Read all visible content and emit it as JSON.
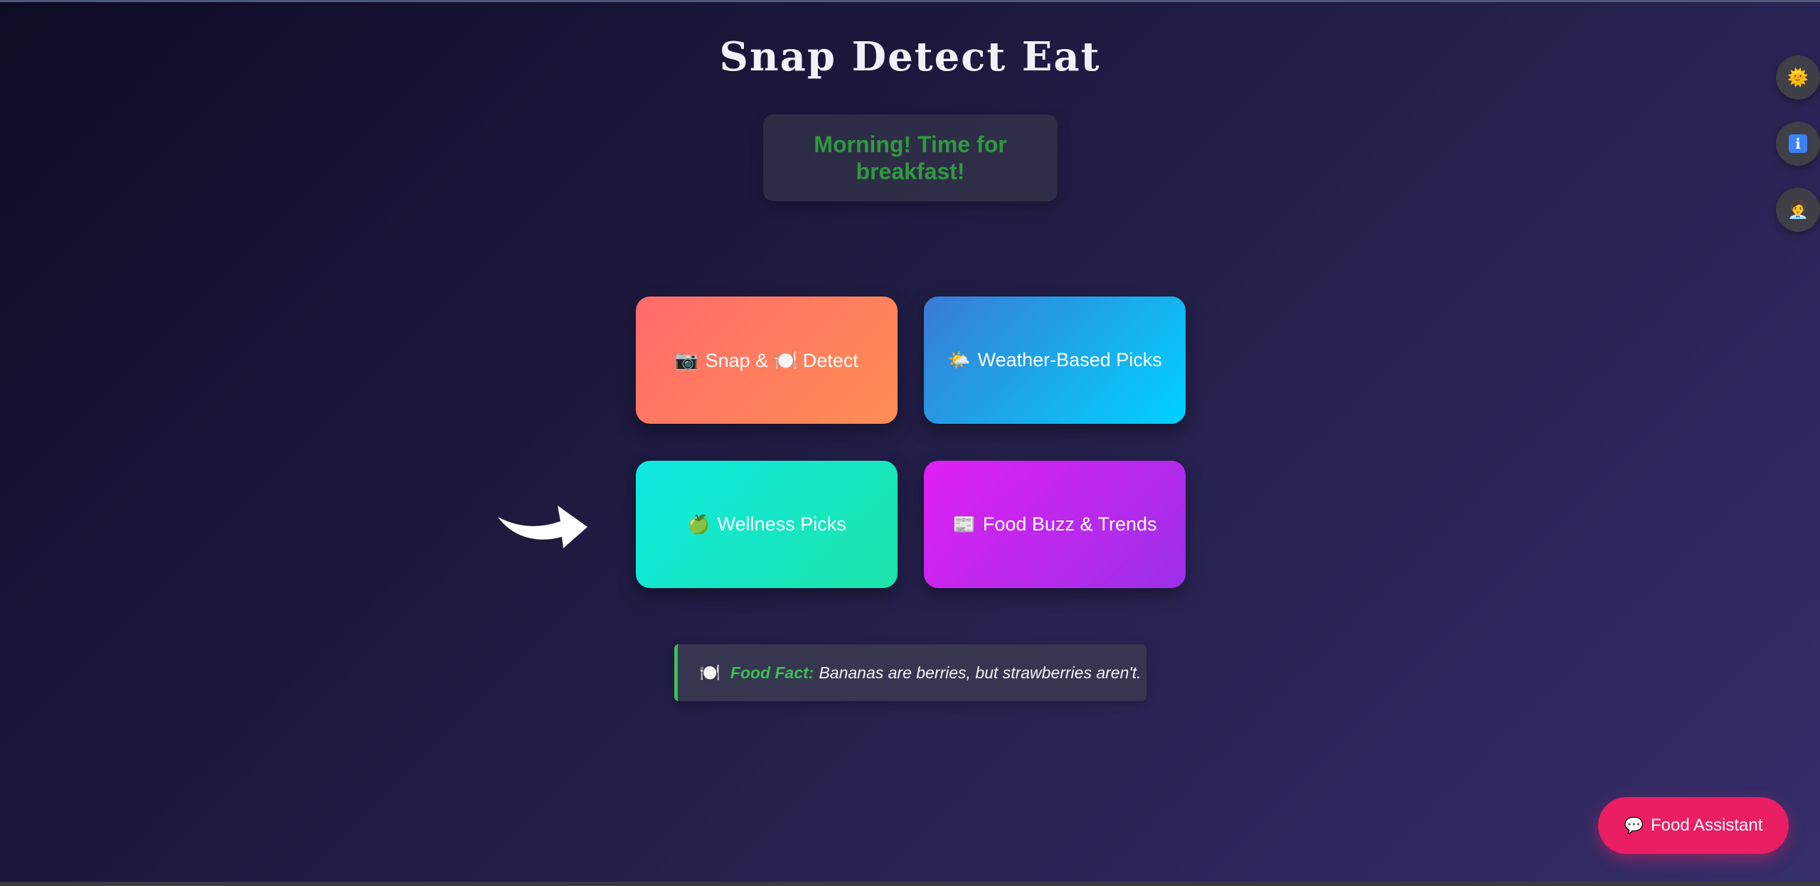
{
  "app": {
    "title": "Snap Detect Eat",
    "greeting": "Morning! Time for breakfast!"
  },
  "cards": [
    {
      "icon": "📷",
      "label": "Snap & 🍽️ Detect"
    },
    {
      "icon": "🌤️",
      "label": "Weather-Based Picks"
    },
    {
      "icon": "🍏",
      "label": "Wellness Picks"
    },
    {
      "icon": "📰",
      "label": "Food Buzz & Trends"
    }
  ],
  "food_fact": {
    "icon": "🍽️",
    "label": "Food Fact:",
    "text": "Bananas are berries, but strawberries aren't."
  },
  "side_buttons": {
    "theme_icon": "🌞",
    "info_icon": "i",
    "profile_icon": "🧑‍💼"
  },
  "assistant": {
    "icon": "💬",
    "label": "Food Assistant"
  },
  "colors": {
    "greeting_text": "#2e9a3e",
    "fact_accent": "#3ebd55",
    "assistant_bg": "#e91e63"
  }
}
